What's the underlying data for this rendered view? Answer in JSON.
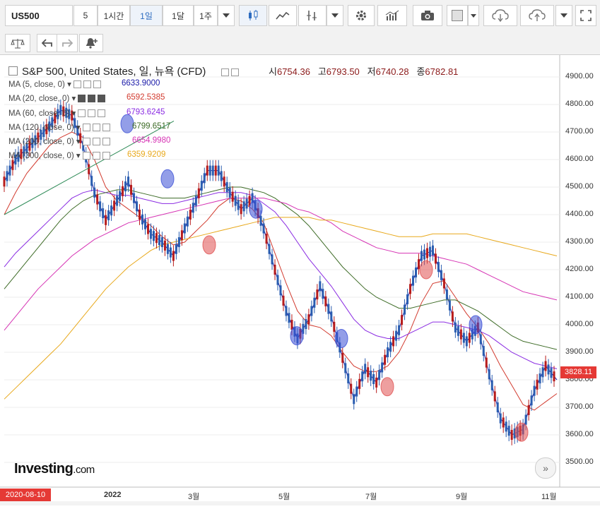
{
  "toolbar": {
    "symbol": "US500",
    "intervals": [
      "5",
      "1시간",
      "1일",
      "1달",
      "1주"
    ],
    "active_interval": "1일"
  },
  "chart_header": {
    "title": "S&P 500, United States, 일, 뉴욕 (CFD)",
    "open_label": "시",
    "open": "6754.36",
    "high_label": "고",
    "high": "6793.50",
    "low_label": "저",
    "low": "6740.28",
    "close_label": "종",
    "close": "6782.81"
  },
  "indicators": [
    {
      "label": "MA (5, close, 0)",
      "value": "6633.9000",
      "color": "#1a1aa8"
    },
    {
      "label": "MA (20, close, 0)",
      "value": "6592.5385",
      "color": "#d23b2f"
    },
    {
      "label": "MA (60, close, 0)",
      "value": "6793.6245",
      "color": "#8a2be2"
    },
    {
      "label": "MA (120, close, 0)",
      "value": "6799.6517",
      "color": "#3d6b26"
    },
    {
      "label": "MA (200, close, 0)",
      "value": "6654.9980",
      "color": "#d633b4"
    },
    {
      "label": "MA (300, close, 0)",
      "value": "6359.9209",
      "color": "#e8a81a"
    }
  ],
  "y_axis": [
    "4900.00",
    "4800.00",
    "4700.00",
    "4600.00",
    "4500.00",
    "4400.00",
    "4300.00",
    "4200.00",
    "4100.00",
    "4000.00",
    "3900.00",
    "3800.00",
    "3700.00",
    "3600.00",
    "3500.00"
  ],
  "x_axis": [
    "2022",
    "3월",
    "5월",
    "7월",
    "9월",
    "11월"
  ],
  "current_price": "3828.11",
  "cursor_date": "2020-08-10",
  "logo": {
    "main": "Investing",
    "suffix": ".com"
  },
  "colors": {
    "up": "#2a5db0",
    "down": "#b71c1c",
    "accent": "#e53935"
  },
  "chart_data": {
    "type": "line",
    "ylim": [
      3450,
      4950
    ],
    "series": [
      {
        "name": "MA (5, close, 0)",
        "color": "#1a1aa8",
        "values": [
          4520,
          4600,
          4640,
          4680,
          4720,
          4780,
          4760,
          4650,
          4480,
          4380,
          4450,
          4520,
          4400,
          4330,
          4300,
          4250,
          4350,
          4450,
          4560,
          4560,
          4480,
          4420,
          4460,
          4350,
          4200,
          4050,
          3950,
          4020,
          4140,
          4030,
          3880,
          3730,
          3840,
          3790,
          3900,
          3980,
          4130,
          4250,
          4270,
          4150,
          3990,
          3940,
          3990,
          3820,
          3660,
          3600,
          3620,
          3760,
          3850,
          3800
        ]
      },
      {
        "name": "MA (20, close, 0)",
        "color": "#d23b2f",
        "values": [
          4400,
          4480,
          4550,
          4600,
          4650,
          4680,
          4700,
          4680,
          4600,
          4500,
          4450,
          4420,
          4390,
          4360,
          4320,
          4290,
          4300,
          4340,
          4380,
          4430,
          4460,
          4450,
          4420,
          4370,
          4260,
          4150,
          4050,
          4000,
          3990,
          3960,
          3900,
          3850,
          3830,
          3830,
          3850,
          3900,
          3980,
          4080,
          4150,
          4160,
          4100,
          4040,
          3990,
          3930,
          3850,
          3780,
          3710,
          3690,
          3720,
          3750
        ]
      },
      {
        "name": "MA (60, close, 0)",
        "color": "#8a2be2",
        "values": [
          4210,
          4260,
          4300,
          4340,
          4380,
          4420,
          4460,
          4480,
          4490,
          4480,
          4470,
          4470,
          4460,
          4450,
          4440,
          4440,
          4450,
          4460,
          4470,
          4480,
          4480,
          4480,
          4470,
          4440,
          4410,
          4360,
          4300,
          4240,
          4190,
          4140,
          4080,
          4020,
          3980,
          3960,
          3950,
          3950,
          3970,
          3990,
          4010,
          4010,
          4000,
          3990,
          3980,
          3960,
          3930,
          3900,
          3880,
          3860,
          3850,
          3840
        ]
      },
      {
        "name": "MA (120, close, 0)",
        "color": "#3d6b26",
        "values": [
          4130,
          4180,
          4230,
          4280,
          4330,
          4380,
          4420,
          4450,
          4470,
          4480,
          4490,
          4490,
          4480,
          4470,
          4460,
          4460,
          4460,
          4470,
          4480,
          4490,
          4500,
          4500,
          4490,
          4480,
          4460,
          4430,
          4400,
          4360,
          4310,
          4260,
          4210,
          4170,
          4130,
          4100,
          4080,
          4060,
          4060,
          4070,
          4080,
          4090,
          4090,
          4070,
          4050,
          4020,
          3990,
          3960,
          3940,
          3930,
          3920,
          3910
        ]
      },
      {
        "name": "MA (200, close, 0)",
        "color": "#d633b4",
        "values": [
          3980,
          4030,
          4080,
          4130,
          4170,
          4210,
          4250,
          4280,
          4310,
          4330,
          4350,
          4370,
          4380,
          4390,
          4400,
          4410,
          4420,
          4430,
          4440,
          4450,
          4460,
          4460,
          4460,
          4460,
          4450,
          4440,
          4420,
          4410,
          4390,
          4370,
          4340,
          4320,
          4300,
          4280,
          4270,
          4260,
          4260,
          4260,
          4250,
          4240,
          4230,
          4220,
          4200,
          4180,
          4160,
          4140,
          4120,
          4110,
          4100,
          4090
        ]
      },
      {
        "name": "MA (300, close, 0)",
        "color": "#e8a81a",
        "values": [
          3730,
          3770,
          3810,
          3850,
          3890,
          3930,
          3980,
          4030,
          4080,
          4130,
          4170,
          4210,
          4240,
          4270,
          4290,
          4300,
          4310,
          4320,
          4330,
          4340,
          4350,
          4360,
          4370,
          4380,
          4390,
          4390,
          4390,
          4390,
          4380,
          4380,
          4370,
          4360,
          4350,
          4340,
          4330,
          4320,
          4320,
          4320,
          4330,
          4330,
          4330,
          4330,
          4320,
          4310,
          4300,
          4290,
          4280,
          4270,
          4260,
          4250
        ]
      }
    ]
  }
}
